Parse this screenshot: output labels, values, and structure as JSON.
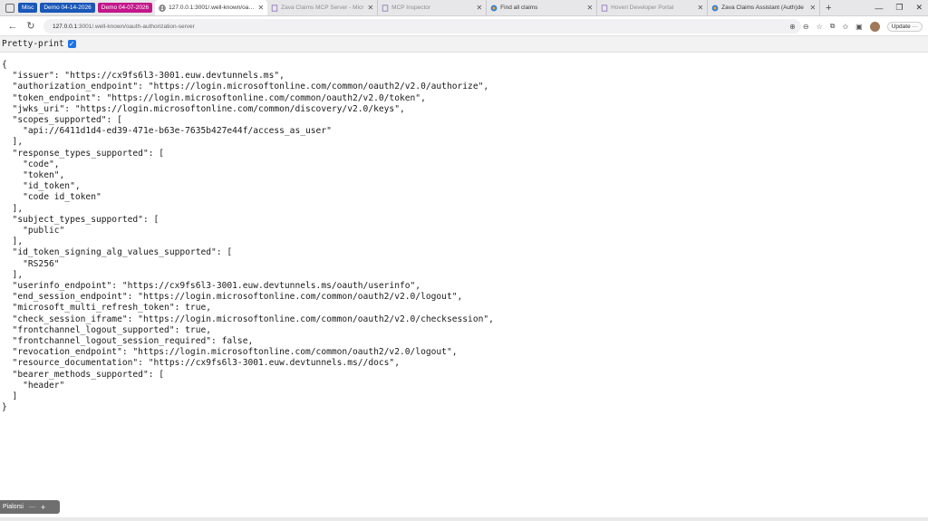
{
  "tab_groups": [
    {
      "label": "Misc",
      "color": "#1a57b8"
    },
    {
      "label": "Demo 04-14-2026",
      "color": "#1a57b8"
    },
    {
      "label": "Demo 04-07-2026",
      "color": "#c2188b"
    }
  ],
  "tabs": [
    {
      "title": "127.0.0.1:3001/.well-known/oauth",
      "icon": "globe-icon",
      "active": true
    },
    {
      "title": "Zava Claims MCP Server - Micr",
      "icon": "page-icon",
      "active": false
    },
    {
      "title": "MCP Inspector",
      "icon": "page-icon",
      "active": false
    },
    {
      "title": "Find all claims",
      "icon": "copilot-icon",
      "active": false
    },
    {
      "title": "Hoveri Developer Portal",
      "icon": "page-icon",
      "active": false
    },
    {
      "title": "Zava Claims Assistant (Auth)de",
      "icon": "copilot-icon",
      "active": false
    }
  ],
  "address": {
    "host": "127.0.0.1",
    "rest": ":3001/.well-known/oauth-authorization-server"
  },
  "toolbar": {
    "update_label": "Update"
  },
  "pretty_print": {
    "label": "Pretty-print",
    "checked": true
  },
  "json_text": "{\n  \"issuer\": \"https://cx9fs6l3-3001.euw.devtunnels.ms\",\n  \"authorization_endpoint\": \"https://login.microsoftonline.com/common/oauth2/v2.0/authorize\",\n  \"token_endpoint\": \"https://login.microsoftonline.com/common/oauth2/v2.0/token\",\n  \"jwks_uri\": \"https://login.microsoftonline.com/common/discovery/v2.0/keys\",\n  \"scopes_supported\": [\n    \"api://6411d1d4-ed39-471e-b63e-7635b427e44f/access_as_user\"\n  ],\n  \"response_types_supported\": [\n    \"code\",\n    \"token\",\n    \"id_token\",\n    \"code id_token\"\n  ],\n  \"subject_types_supported\": [\n    \"public\"\n  ],\n  \"id_token_signing_alg_values_supported\": [\n    \"RS256\"\n  ],\n  \"userinfo_endpoint\": \"https://cx9fs6l3-3001.euw.devtunnels.ms/oauth/userinfo\",\n  \"end_session_endpoint\": \"https://login.microsoftonline.com/common/oauth2/v2.0/logout\",\n  \"microsoft_multi_refresh_token\": true,\n  \"check_session_iframe\": \"https://login.microsoftonline.com/common/oauth2/v2.0/checksession\",\n  \"frontchannel_logout_supported\": true,\n  \"frontchannel_logout_session_required\": false,\n  \"revocation_endpoint\": \"https://login.microsoftonline.com/common/oauth2/v2.0/logout\",\n  \"resource_documentation\": \"https://cx9fs6l3-3001.euw.devtunnels.ms//docs\",\n  \"bearer_methods_supported\": [\n    \"header\"\n  ]\n}",
  "bottom_bar": {
    "label": "Pialorsi"
  }
}
